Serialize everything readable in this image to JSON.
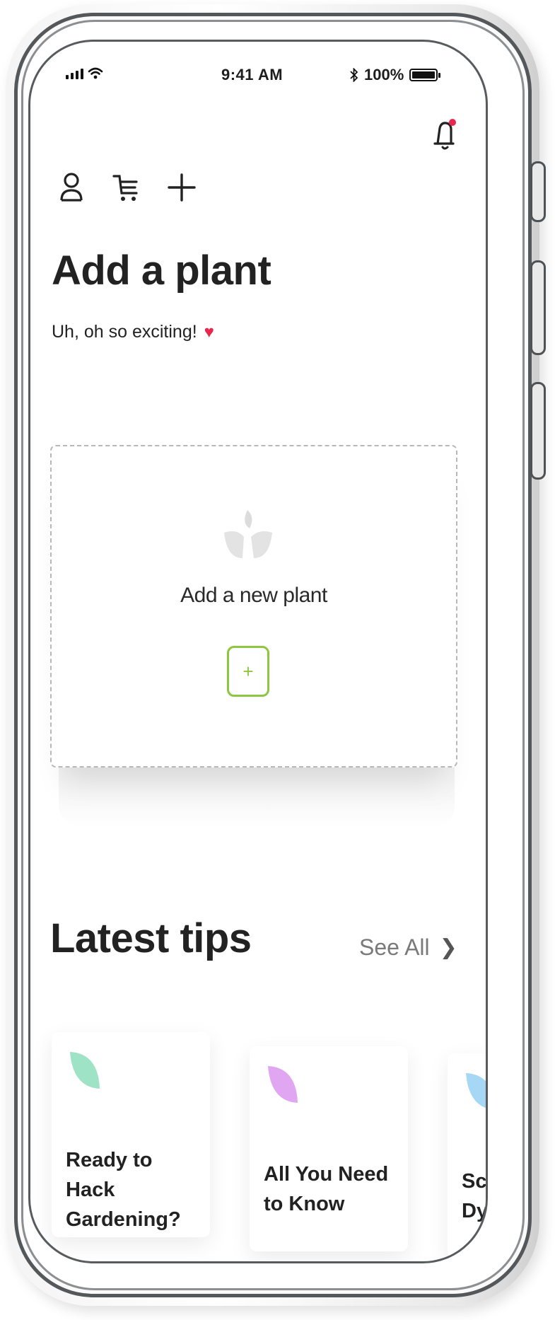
{
  "status_bar": {
    "time": "9:41 AM",
    "battery": "100%",
    "battery_level": 1.0,
    "icons": [
      "signal-icon",
      "wifi-icon",
      "bluetooth-icon",
      "battery-icon"
    ]
  },
  "header": {
    "icons": [
      "user-icon",
      "cart-icon",
      "plus-icon"
    ],
    "notification_icon": "bell-icon",
    "notification_dot_color": "#e6284f",
    "title": "Add a plant",
    "subtitle": "Uh, oh so exciting!",
    "subtitle_icon": "heart-icon",
    "heart_color": "#e6284f"
  },
  "add_card": {
    "label": "Add a new plant",
    "button_label": "+",
    "accent_color": "#8dc63f",
    "icon": "plant-icon"
  },
  "tips_section": {
    "title": "Latest tips",
    "see_all": "See All",
    "cards": [
      {
        "title_line1": "Ready to Hack",
        "title_line2": "Gardening?",
        "leaf_color": "#9fe3c6"
      },
      {
        "title_line1": "All You Need",
        "title_line2": "to Know",
        "leaf_color": "#e0a6f2"
      },
      {
        "title_line1": "Sc",
        "title_line2": "Dy",
        "leaf_color": "#a6d8f5"
      }
    ]
  }
}
